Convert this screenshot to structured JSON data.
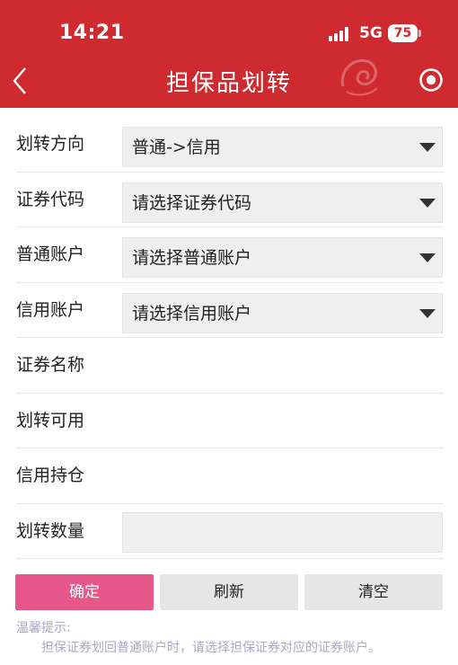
{
  "status_bar": {
    "time": "14:21",
    "network": "5G",
    "battery": "75"
  },
  "header": {
    "title": "担保品划转",
    "back_icon": "chevron-left-icon",
    "right_icon": "record-icon",
    "logo_icon": "dragon-logo-icon"
  },
  "form": {
    "direction": {
      "label": "划转方向",
      "value": "普通->信用"
    },
    "security_code": {
      "label": "证券代码",
      "value": "请选择证券代码"
    },
    "normal_account": {
      "label": "普通账户",
      "value": "请选择普通账户"
    },
    "credit_account": {
      "label": "信用账户",
      "value": "请选择信用账户"
    },
    "security_name": {
      "label": "证券名称"
    },
    "transferable": {
      "label": "划转可用"
    },
    "credit_position": {
      "label": "信用持仓"
    },
    "quantity": {
      "label": "划转数量",
      "value": ""
    }
  },
  "actions": {
    "confirm": "确定",
    "refresh": "刷新",
    "clear": "清空"
  },
  "tip": {
    "title": "温馨提示:",
    "text": "担保证券划回普通账户时，请选择担保证券对应的证券账户。"
  },
  "colors": {
    "header_bg": "#cf2a2f",
    "confirm_bg": "#e8578a",
    "tip_text": "#a9a9c4"
  }
}
